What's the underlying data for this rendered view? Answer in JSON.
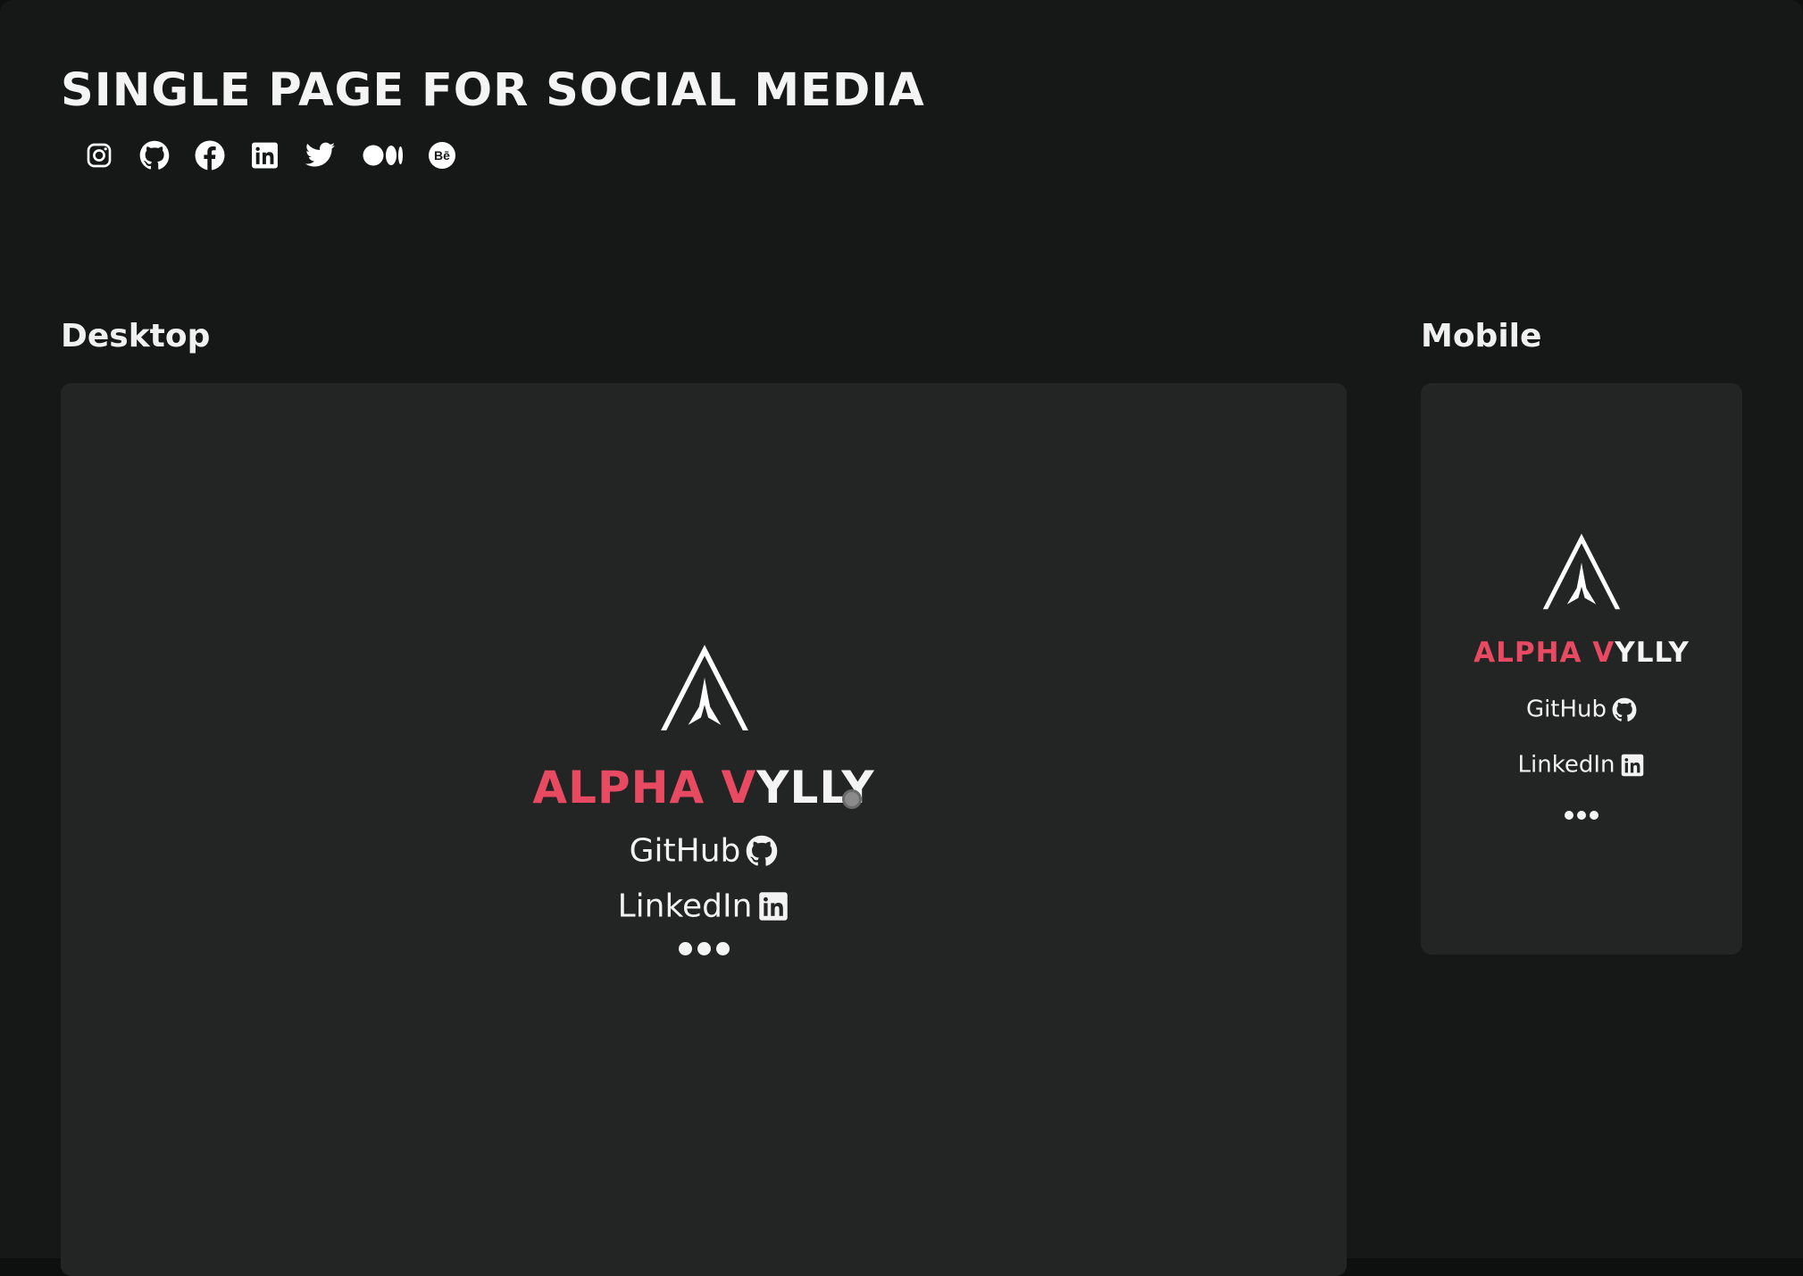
{
  "header": {
    "title": "SINGLE PAGE FOR SOCIAL MEDIA",
    "social_icons": [
      "instagram-icon",
      "github-icon",
      "facebook-icon",
      "linkedin-icon",
      "twitter-icon",
      "medium-icon",
      "behance-icon"
    ]
  },
  "sections": {
    "desktop_label": "Desktop",
    "mobile_label": "Mobile"
  },
  "profile": {
    "name_accent": "ALPHA V",
    "name_rest": "YLLY",
    "links": [
      {
        "label": "GitHub",
        "icon": "github-icon"
      },
      {
        "label": "LinkedIn",
        "icon": "linkedin-icon"
      }
    ],
    "more_icon": "more-dots-icon"
  },
  "colors": {
    "background": "#161717",
    "card": "#232424",
    "accent": "#e84a62",
    "text": "#f4f4f4"
  }
}
